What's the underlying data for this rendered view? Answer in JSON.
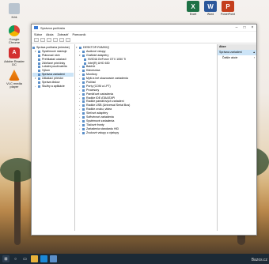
{
  "desktop": {
    "icons": [
      {
        "label": "Google Chrome"
      },
      {
        "label": "Adobe Reader DC"
      },
      {
        "label": "VLC media player"
      }
    ],
    "top_apps": [
      {
        "label": "Excel",
        "letter": "X",
        "color": "#1e7145"
      },
      {
        "label": "Word",
        "letter": "W",
        "color": "#2b579a"
      },
      {
        "label": "PowerPoint",
        "letter": "P",
        "color": "#c43e1c"
      }
    ],
    "bin_label": "Kôš"
  },
  "window": {
    "title": "Správca počítača",
    "menu": [
      "Súbor",
      "Akcia",
      "Zobraziť",
      "Pomocník"
    ],
    "left_tree": [
      "Správa počítača (miestne)",
      "Systémové nástroje",
      "Plánovač úloh",
      "Prehliadač udalostí",
      "Zdieľané priečinky",
      "Lokálni používatelia",
      "Výkon",
      "Správca zariadení",
      "Ukladací priestor",
      "Správa diskov",
      "Služby a aplikácie"
    ],
    "device_tree": [
      "DESKTOP-R4M9XQ",
      "Audiové vstupy",
      "Grafické adaptéry",
      "NVIDIA GeForce GTX 1050 Ti",
      "Intel(R) UHD 630",
      "Batérie",
      "Klávesnica",
      "Monitory",
      "Myši a iné ukazovacie zariadenia",
      "Počítač",
      "Porty (COM a LPT)",
      "Procesory",
      "Pamäťové zariadenia",
      "Radiče IDE ATA/ATAPI",
      "Radiče pamäťových zariadení",
      "Radiče USB (Universal Serial Bus)",
      "Radiče zvuku, videa",
      "Sieťové adaptéry",
      "Softvérové zariadenia",
      "Systémové zariadenia",
      "Tlačové fronty",
      "Zariadenia standardu HID",
      "Zvukové vstupy a výstupy"
    ],
    "actions": {
      "header": "Akce",
      "selected": "Správca zariadení",
      "more": "Ďalšie akcie"
    }
  },
  "taskbar": {
    "watermark": "Bazos.cz"
  }
}
